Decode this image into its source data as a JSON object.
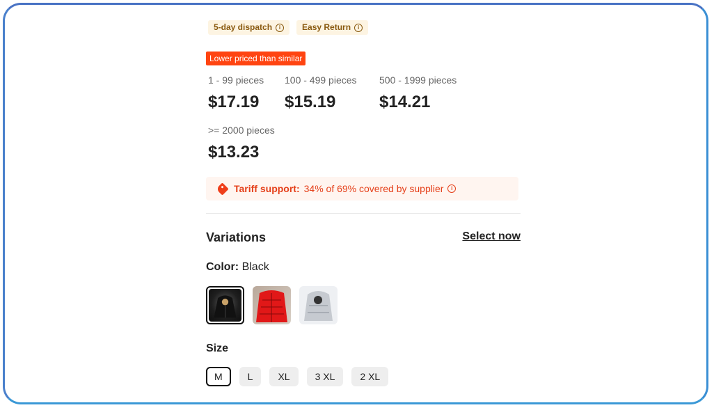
{
  "badges": [
    {
      "label": "5-day dispatch",
      "icon": "info-icon"
    },
    {
      "label": "Easy Return",
      "icon": "info-icon"
    }
  ],
  "lower_price_tag": "Lower priced than similar",
  "price_tiers": [
    {
      "qty": "1 - 99 pieces",
      "price": "$17.19"
    },
    {
      "qty": "100 - 499 pieces",
      "price": "$15.19"
    },
    {
      "qty": "500 - 1999 pieces",
      "price": "$14.21"
    },
    {
      "qty": ">= 2000 pieces",
      "price": "$13.23"
    }
  ],
  "tariff": {
    "label": "Tariff support:",
    "text": "34% of 69% covered by supplier",
    "color": "#e5401a"
  },
  "variations": {
    "title": "Variations",
    "select_now": "Select now",
    "color_label": "Color:",
    "color_value": "Black",
    "swatches": [
      {
        "name": "black-jacket",
        "color": "#2a2a2a",
        "selected": true
      },
      {
        "name": "red-jacket",
        "color": "#e11818",
        "selected": false
      },
      {
        "name": "silver-jacket",
        "color": "#c9ccd2",
        "selected": false
      }
    ],
    "size_title": "Size",
    "sizes": [
      {
        "label": "M",
        "selected": true
      },
      {
        "label": "L",
        "selected": false
      },
      {
        "label": "XL",
        "selected": false
      },
      {
        "label": "3 XL",
        "selected": false
      },
      {
        "label": "2 XL",
        "selected": false
      }
    ]
  },
  "accent_color": "#ff4411"
}
